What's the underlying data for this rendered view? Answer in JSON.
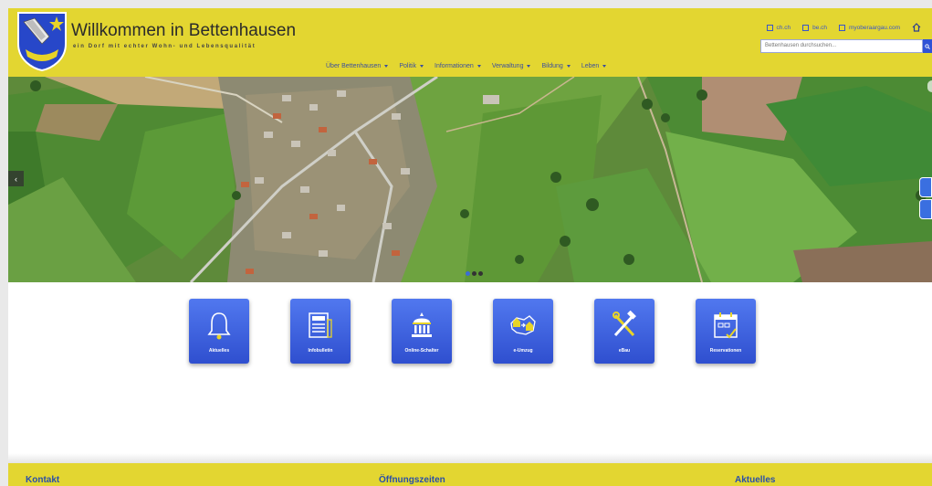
{
  "header": {
    "title": "Willkommen in Bettenhausen",
    "tagline": "ein Dorf mit echter Wohn- und Lebensqualität",
    "links": [
      {
        "label": "ch.ch"
      },
      {
        "label": "be.ch"
      },
      {
        "label": "myoberaargau.com"
      }
    ],
    "search": {
      "placeholder": "Bettenhausen durchsuchen..."
    },
    "nav": [
      {
        "label": "Über Bettenhausen"
      },
      {
        "label": "Politik"
      },
      {
        "label": "Informationen"
      },
      {
        "label": "Verwaltung"
      },
      {
        "label": "Bildung"
      },
      {
        "label": "Leben"
      }
    ]
  },
  "carousel": {
    "slide_count": 3,
    "active_slide": 1
  },
  "tiles": [
    {
      "label": "Aktuelles",
      "icon": "bell-icon"
    },
    {
      "label": "Infobulletin",
      "icon": "newspaper-icon"
    },
    {
      "label": "Online-Schalter",
      "icon": "building-icon"
    },
    {
      "label": "e-Umzug",
      "icon": "moving-map-icon"
    },
    {
      "label": "eBau",
      "icon": "hammer-wrench-icon"
    },
    {
      "label": "Reservationen",
      "icon": "calendar-icon"
    }
  ],
  "footer": {
    "kontakt": "Kontakt",
    "oeffnungszeiten": "Öffnungszeiten",
    "aktuelles": "Aktuelles"
  },
  "colors": {
    "brand_yellow": "#e3d631",
    "tile_blue": "#3a5de0",
    "link_blue": "#3a56c8"
  }
}
